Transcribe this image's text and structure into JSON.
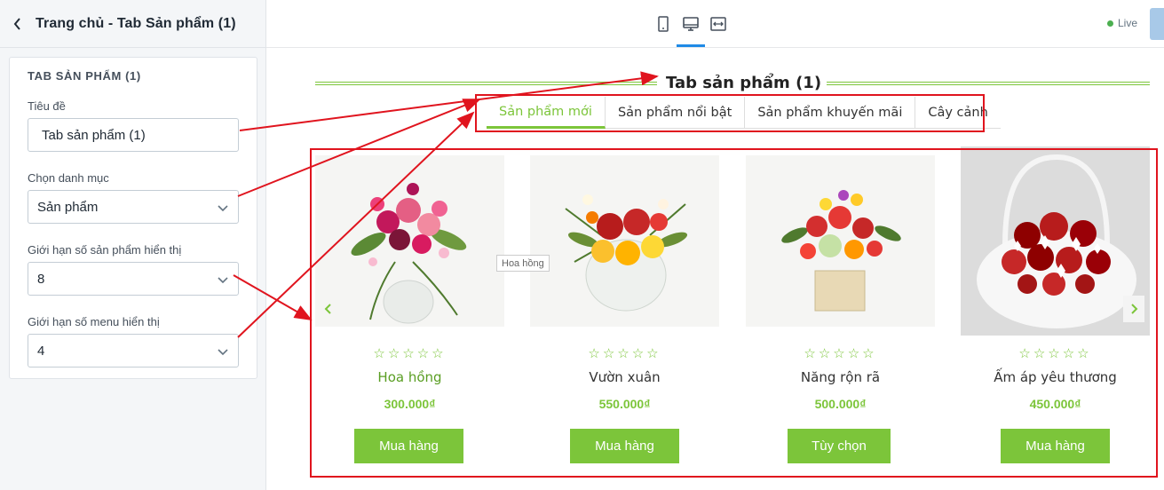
{
  "sidebar": {
    "title": "Trang chủ - Tab Sản phẩm (1)",
    "card_title": "TAB SẢN PHẨM (1)",
    "fields": [
      {
        "label": "Tiêu đề",
        "value": "Tab sản phẩm (1)"
      },
      {
        "label": "Chọn danh mục",
        "value": "Sản phẩm"
      },
      {
        "label": "Giới hạn số sản phẩm hiển thị",
        "value": "8"
      },
      {
        "label": "Giới hạn số menu hiển thị",
        "value": "4"
      }
    ]
  },
  "topbar": {
    "devices": [
      "mobile-icon",
      "desktop-icon",
      "fullwidth-icon"
    ],
    "active_device": "desktop-icon",
    "live_label": "Live",
    "accent": "#1f8ae6"
  },
  "preview": {
    "section_title": "Tab sản phẩm (1)",
    "tabs": [
      {
        "label": "Sản phẩm mới",
        "active": true
      },
      {
        "label": "Sản phẩm nổi bật",
        "active": false
      },
      {
        "label": "Sản phẩm khuyến mãi",
        "active": false
      },
      {
        "label": "Cây cảnh",
        "active": false
      }
    ],
    "tooltip": "Hoa hồng",
    "products": [
      {
        "name": "Hoa hồng",
        "price": "300.000₫",
        "button": "Mua hàng",
        "rating": "0/5"
      },
      {
        "name": "Vườn xuân",
        "price": "550.000₫",
        "button": "Mua hàng",
        "rating": "0/5"
      },
      {
        "name": "Năng rộn rã",
        "price": "500.000₫",
        "button": "Tùy chọn",
        "rating": "0/5"
      },
      {
        "name": "Ấm áp yêu thương",
        "price": "450.000₫",
        "button": "Mua hàng",
        "rating": "0/5"
      }
    ],
    "stars": "☆☆☆☆☆",
    "accent": "#7cc53a",
    "annotation_color": "#e0141e"
  }
}
